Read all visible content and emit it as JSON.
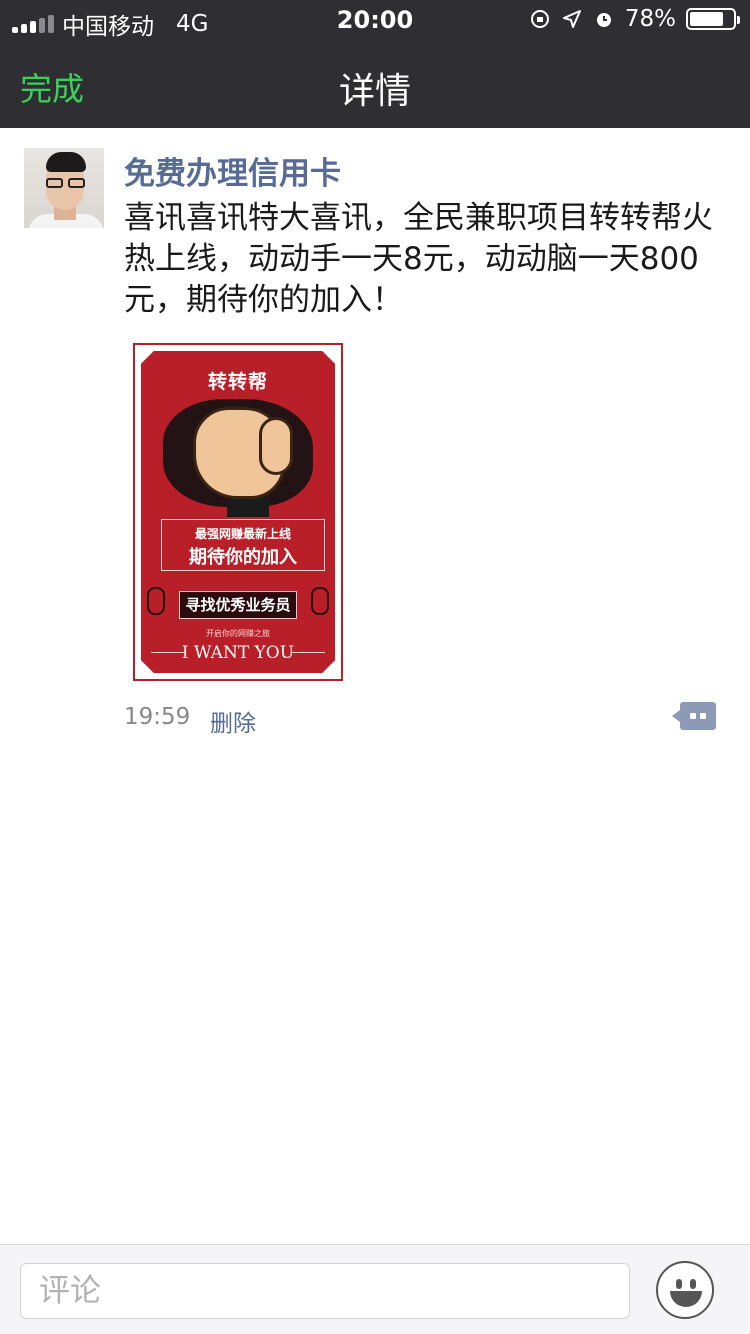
{
  "status_bar": {
    "carrier": "中国移动",
    "network": "4G",
    "time": "20:00",
    "battery_text": "78%",
    "battery_level": 0.78,
    "icons": [
      "signal-icon",
      "orientation-lock-icon",
      "location-icon",
      "alarm-icon",
      "battery-icon"
    ]
  },
  "nav": {
    "done_label": "完成",
    "title": "详情"
  },
  "post": {
    "author": "免费办理信用卡",
    "text": "喜讯喜讯特大喜讯，全民兼职项目转转帮火热上线，动动手一天8元，动动脑一天800元，期待你的加入！",
    "time": "19:59",
    "delete_label": "删除"
  },
  "poster": {
    "brand": "转转帮",
    "line_a": "最强网赚最新上线",
    "line_b": "期待你的加入",
    "tag": "寻找优秀业务员",
    "small": "开启你的网赚之旅",
    "want": "I WANT YOU"
  },
  "comment_bar": {
    "placeholder": "评论"
  },
  "colors": {
    "nav_bg": "#2e2e33",
    "done_green": "#3ad05b",
    "link_blue": "#576b95",
    "poster_red": "#b91f28"
  }
}
